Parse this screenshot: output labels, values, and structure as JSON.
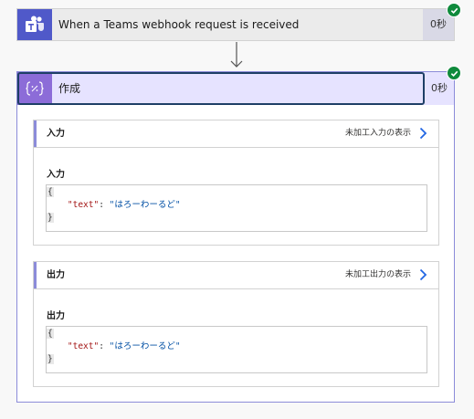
{
  "trigger": {
    "title": "When a Teams webhook request is received",
    "duration": "0秒",
    "icon": "teams-icon",
    "status": "succeeded"
  },
  "compose": {
    "title": "作成",
    "duration": "0秒",
    "icon": "compose-icon",
    "status": "succeeded",
    "inputs": {
      "header": "入力",
      "raw_link": "未加工入力の表示",
      "label": "入力",
      "json": {
        "open": "{",
        "key": "\"text\"",
        "colon": ": ",
        "value": "\"はろーわーるど\"",
        "close": "}"
      }
    },
    "outputs": {
      "header": "出力",
      "raw_link": "未加工出力の表示",
      "label": "出力",
      "json": {
        "open": "{",
        "key": "\"text\"",
        "colon": ": ",
        "value": "\"はろーわーるど\"",
        "close": "}"
      }
    }
  },
  "colors": {
    "teams": "#5059c9",
    "compose": "#8c6cd8",
    "success": "#0f8a3c",
    "link": "#2266e3"
  }
}
